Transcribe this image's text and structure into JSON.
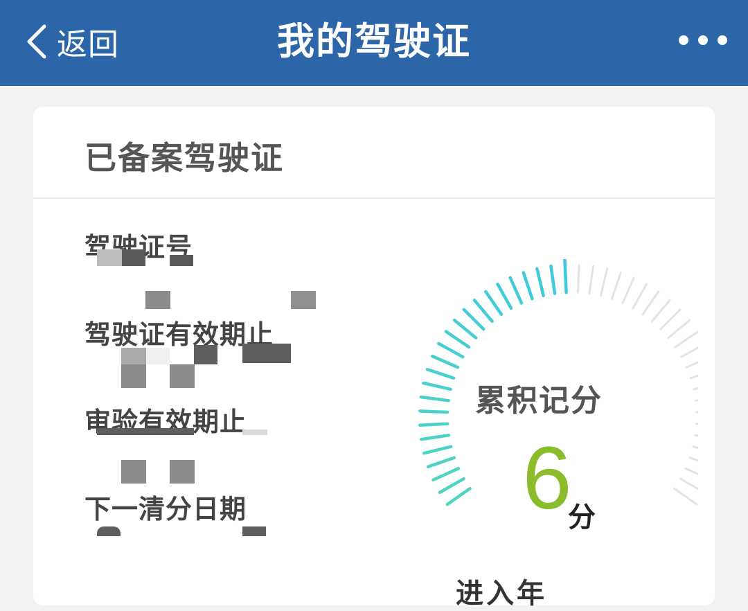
{
  "header": {
    "back_label": "返回",
    "title": "我的驾驶证",
    "bg_color": "#2d66a8"
  },
  "card": {
    "title": "已备案驾驶证",
    "fields": [
      {
        "label": "驾驶证号"
      },
      {
        "label": "驾驶证有效期止"
      },
      {
        "label": "审验有效期止"
      },
      {
        "label": "下一清分日期"
      }
    ]
  },
  "gauge": {
    "label": "累积记分",
    "value": "6",
    "unit": "分",
    "max_points": 12,
    "fill_fraction": 0.5,
    "active_colors": [
      "#4fd6c0",
      "#3ec8e0"
    ],
    "inactive_color": "#e4e4e4"
  },
  "footer": {
    "partial_text": "进入年"
  },
  "icons": {
    "back": "chevron-left-icon",
    "more": "more-dots-icon"
  }
}
